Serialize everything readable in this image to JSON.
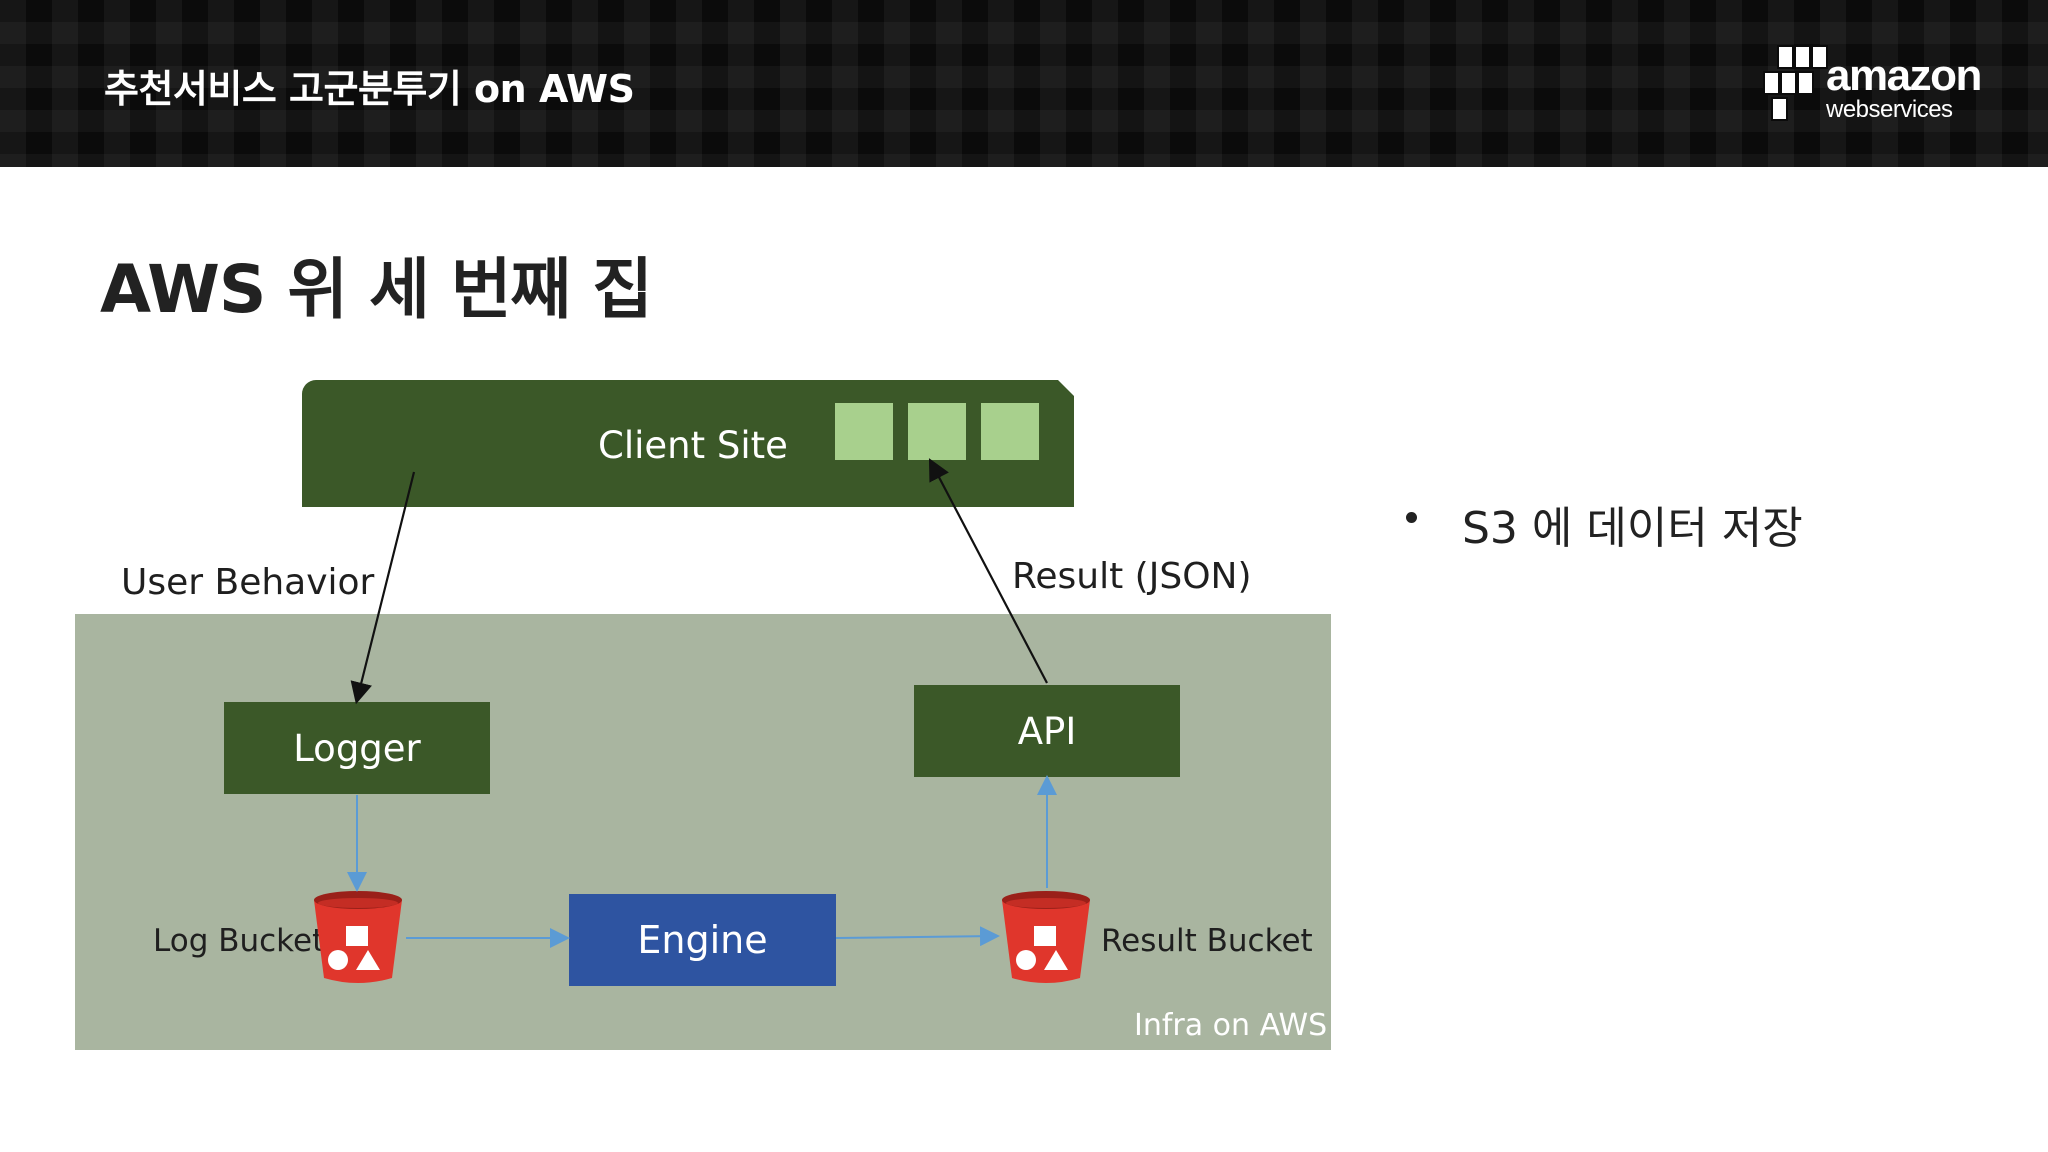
{
  "header": {
    "title": "추천서비스 고군분투기 on AWS",
    "logo": {
      "word": "amazon",
      "sub": "webservices"
    }
  },
  "slide": {
    "title": "AWS 위 세 번째 집"
  },
  "diagram": {
    "client_site": "Client Site",
    "user_behavior": "User Behavior",
    "result_json": "Result (JSON)",
    "logger": "Logger",
    "api": "API",
    "engine": "Engine",
    "log_bucket": "Log Bucket",
    "result_bucket": "Result Bucket",
    "infra": "Infra on AWS"
  },
  "bullets": [
    "S3 에 데이터 저장"
  ],
  "colors": {
    "header_bg": "#0b0b0b",
    "component_green": "#3b5828",
    "light_green": "#a8d08d",
    "infra_bg": "#a9b5a0",
    "engine_blue": "#2e54a1",
    "bucket_red": "#e0362c",
    "arrow_blue": "#5b9bd5"
  }
}
